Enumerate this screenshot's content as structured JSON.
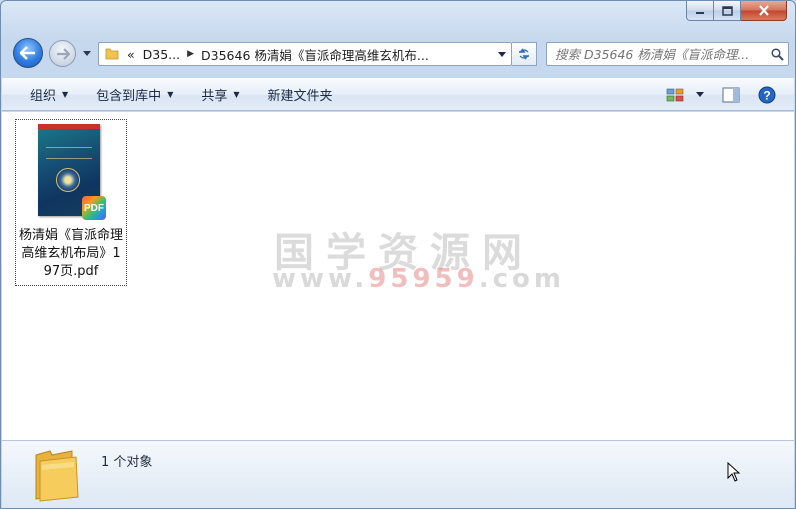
{
  "window": {
    "controls": {
      "minimize": "minimize",
      "maximize": "maximize",
      "close": "close"
    }
  },
  "navigation": {
    "address": {
      "overflow_glyph": "«",
      "crumbs": [
        "D35...",
        "D35646 杨清娟《盲派命理高维玄机布..."
      ]
    },
    "search": {
      "placeholder": "搜索 D35646 杨清娟《盲派命理..."
    }
  },
  "toolbar": {
    "organize": "组织",
    "include_in_library": "包含到库中",
    "share": "共享",
    "new_folder": "新建文件夹"
  },
  "content": {
    "files": [
      {
        "name": "杨清娟《盲派命理高维玄机布局》197页.pdf",
        "type": "pdf",
        "badge": "PDF"
      }
    ],
    "watermark": {
      "cn": "国学资源网",
      "url_prefix": "www.",
      "url_highlight": "95959",
      "url_suffix": ".com"
    }
  },
  "details": {
    "count_text": "1 个对象"
  },
  "colors": {
    "accent": "#2f7de0",
    "close": "#c2462d",
    "folder": "#f2c24e"
  }
}
